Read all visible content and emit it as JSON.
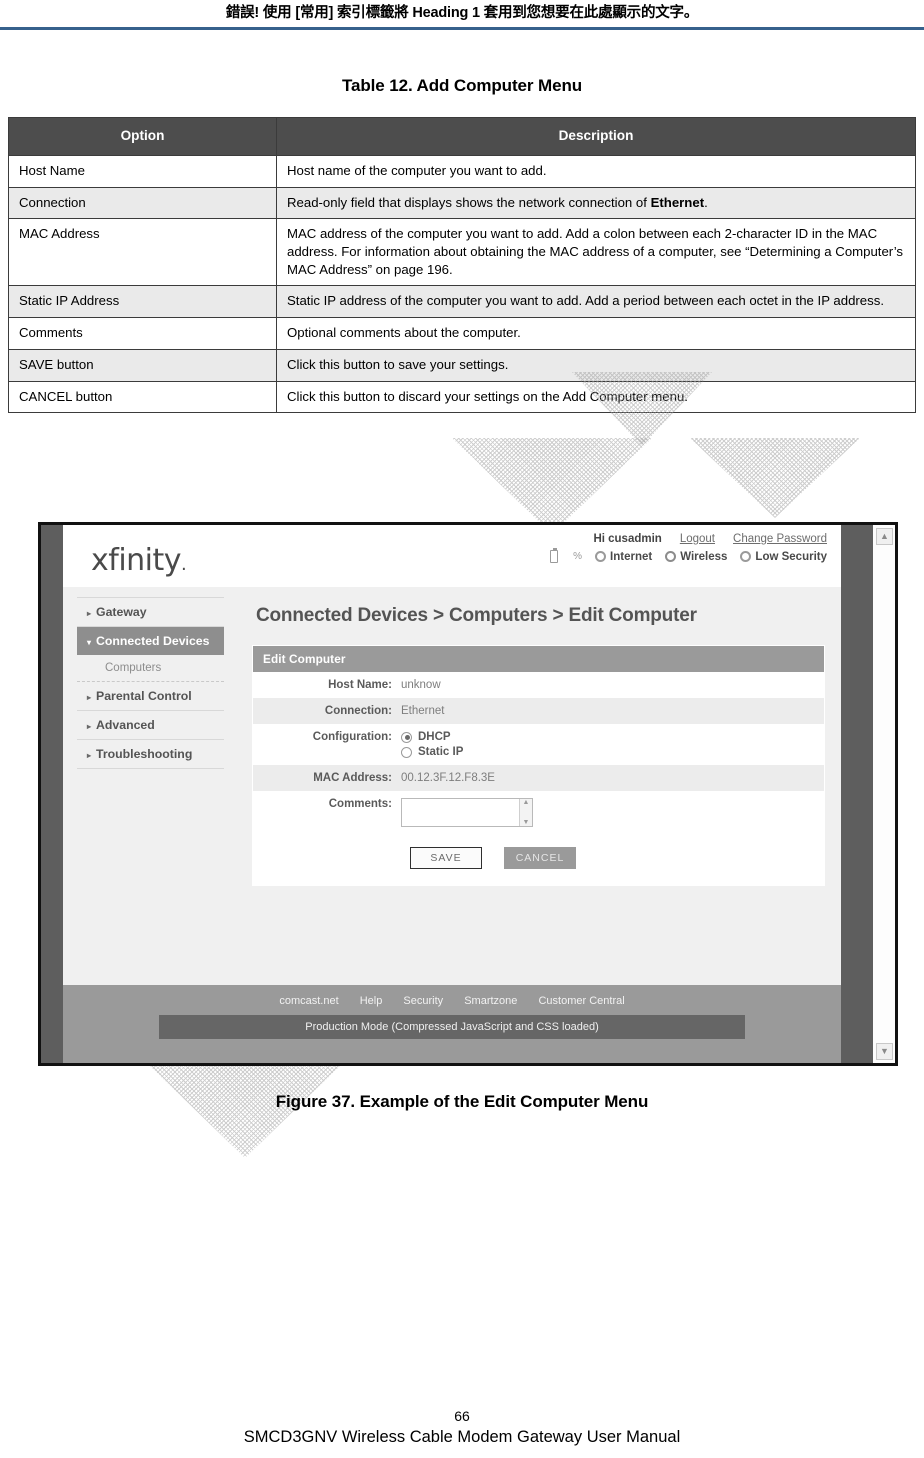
{
  "document": {
    "running_header": "錯誤! 使用 [常用] 索引標籤將 Heading 1 套用到您想要在此處顯示的文字。",
    "table_caption": "Table 12. Add Computer Menu",
    "figure_caption": "Figure 37. Example of the Edit Computer Menu",
    "page_number": "66",
    "footer_title": "SMCD3GNV Wireless Cable Modem Gateway User Manual",
    "accent_rule_color": "#36618c"
  },
  "table": {
    "headers": [
      "Option",
      "Description"
    ],
    "rows": [
      {
        "option": "Host Name",
        "description": "Host name of the computer you want to add."
      },
      {
        "option": "Connection",
        "description_pre": "Read-only field that displays shows the network connection of ",
        "description_bold": "Ethernet",
        "description_post": "."
      },
      {
        "option": "MAC Address",
        "description": "MAC address of the computer you want to add. Add a colon between each 2-character ID in the MAC address. For information about obtaining the MAC address of a computer, see “Determining a Computer’s MAC Address” on page 196."
      },
      {
        "option": "Static IP Address",
        "description": "Static IP address of the computer you want to add. Add a period between each octet in the IP address."
      },
      {
        "option": "Comments",
        "description": "Optional comments about the computer."
      },
      {
        "option": "SAVE button",
        "description": "Click this button to save your settings."
      },
      {
        "option": "CANCEL button",
        "description": "Click this button to discard your settings on the Add Computer menu."
      }
    ]
  },
  "figure": {
    "brand": "xfinity",
    "account": {
      "greeting": "Hi cusadmin",
      "logout": "Logout",
      "change_password": "Change Password",
      "battery_percent": "%",
      "status_internet": "Internet",
      "status_wireless": "Wireless",
      "status_security": "Low Security"
    },
    "sidebar": [
      {
        "label": "Gateway",
        "type": "top",
        "active": false
      },
      {
        "label": "Connected Devices",
        "type": "top",
        "active": true
      },
      {
        "label": "Computers",
        "type": "sub",
        "active": false
      },
      {
        "label": "Parental Control",
        "type": "top",
        "active": false
      },
      {
        "label": "Advanced",
        "type": "top",
        "active": false
      },
      {
        "label": "Troubleshooting",
        "type": "top",
        "active": false
      }
    ],
    "breadcrumb": "Connected Devices > Computers > Edit Computer",
    "panel_title": "Edit Computer",
    "fields": {
      "host_name_label": "Host Name:",
      "host_name_value": "unknow",
      "connection_label": "Connection:",
      "connection_value": "Ethernet",
      "configuration_label": "Configuration:",
      "config_dhcp": "DHCP",
      "config_static": "Static IP",
      "config_selected": "DHCP",
      "mac_label": "MAC Address:",
      "mac_value": "00.12.3F.12.F8.3E",
      "comments_label": "Comments:",
      "comments_value": ""
    },
    "buttons": {
      "save": "SAVE",
      "cancel": "CANCEL"
    },
    "footer_links": [
      "comcast.net",
      "Help",
      "Security",
      "Smartzone",
      "Customer Central"
    ],
    "footer_bar": "Production Mode (Compressed JavaScript and CSS loaded)"
  }
}
